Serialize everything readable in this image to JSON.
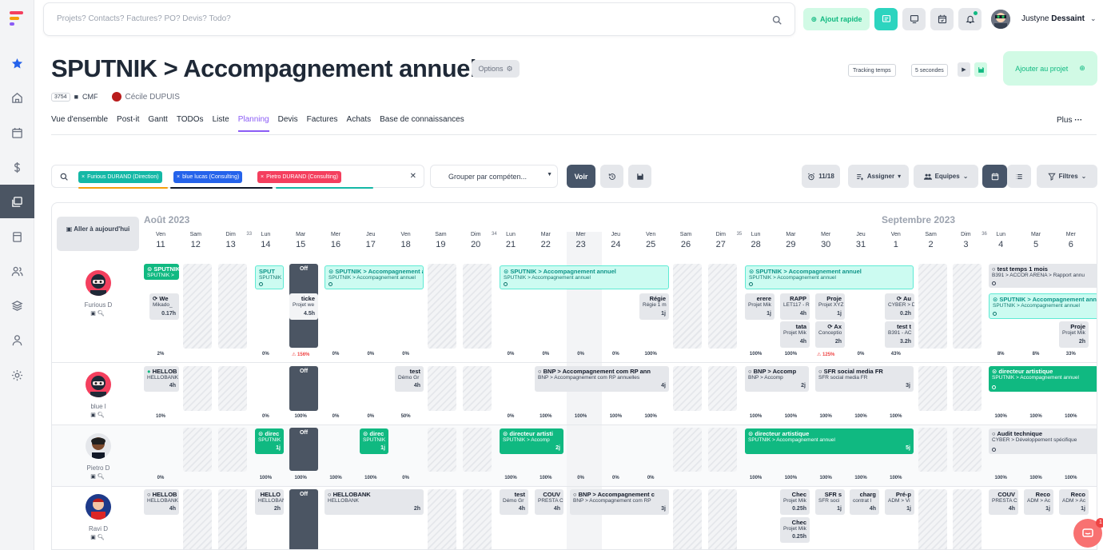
{
  "search": {
    "placeholder": "Projets? Contacts? Factures? PO? Devis? Todo?"
  },
  "topbar": {
    "ajout_rapide": "Ajout rapide"
  },
  "user": {
    "first": "Justyne",
    "last": "Dessaint"
  },
  "project": {
    "title": "SPUTNIK > Accompagnement annuel",
    "options": "Options",
    "id": "3754",
    "client": "CMF",
    "owner": "Cécile DUPUIS",
    "tracking": "Tracking temps",
    "seconds": "5 secondes",
    "add_to_project": "Ajouter au projet"
  },
  "tabs": [
    "Vue d'ensemble",
    "Post-it",
    "Gantt",
    "TODOs",
    "Liste",
    "Planning",
    "Devis",
    "Factures",
    "Achats",
    "Base de connaissances"
  ],
  "active_tab": "Planning",
  "plus": "Plus",
  "filters": {
    "chips": [
      "Furious DURAND (Direction)",
      "blue lucas (Consulting)",
      "Pietro DURAND (Consulting)"
    ],
    "grouper": "Grouper par compéten...",
    "voir": "Voir",
    "count": "11/18",
    "assigner": "Assigner",
    "equipes": "Equipes",
    "filtres": "Filtres"
  },
  "planning": {
    "today_btn": "Aller à aujourd'hui",
    "months": [
      "Août 2023",
      "Septembre 2023"
    ],
    "off_label": "Off",
    "days": [
      {
        "n": "Ven",
        "d": "11"
      },
      {
        "n": "Sam",
        "d": "12"
      },
      {
        "n": "Dim",
        "d": "13"
      },
      {
        "n": "Lun",
        "d": "14",
        "w": "33"
      },
      {
        "n": "Mar",
        "d": "15"
      },
      {
        "n": "Mer",
        "d": "16"
      },
      {
        "n": "Jeu",
        "d": "17"
      },
      {
        "n": "Ven",
        "d": "18"
      },
      {
        "n": "Sam",
        "d": "19"
      },
      {
        "n": "Dim",
        "d": "20"
      },
      {
        "n": "Lun",
        "d": "21",
        "w": "34"
      },
      {
        "n": "Mar",
        "d": "22"
      },
      {
        "n": "Mer",
        "d": "23"
      },
      {
        "n": "Jeu",
        "d": "24"
      },
      {
        "n": "Ven",
        "d": "25"
      },
      {
        "n": "Sam",
        "d": "26"
      },
      {
        "n": "Dim",
        "d": "27"
      },
      {
        "n": "Lun",
        "d": "28",
        "w": "35"
      },
      {
        "n": "Mar",
        "d": "29"
      },
      {
        "n": "Mer",
        "d": "30"
      },
      {
        "n": "Jeu",
        "d": "31"
      },
      {
        "n": "Ven",
        "d": "1"
      },
      {
        "n": "Sam",
        "d": "2"
      },
      {
        "n": "Dim",
        "d": "3"
      },
      {
        "n": "Lun",
        "d": "4",
        "w": "36"
      },
      {
        "n": "Mar",
        "d": "5"
      },
      {
        "n": "Mer",
        "d": "6"
      }
    ],
    "people": [
      {
        "name": "Furious D",
        "pct": [
          "2%",
          "",
          "",
          "0%",
          "156%",
          "0%",
          "0%",
          "0%",
          "",
          "",
          "0%",
          "0%",
          "0%",
          "0%",
          "100%",
          "",
          "",
          "100%",
          "100%",
          "125%",
          "0%",
          "43%",
          "",
          "",
          "8%",
          "8%",
          "33%"
        ]
      },
      {
        "name": "blue l",
        "pct": [
          "10%",
          "",
          "",
          "0%",
          "100%",
          "0%",
          "0%",
          "50%",
          "",
          "",
          "0%",
          "100%",
          "100%",
          "100%",
          "100%",
          "",
          "",
          "100%",
          "100%",
          "100%",
          "100%",
          "100%",
          "",
          "",
          "100%",
          "100%",
          "100%"
        ]
      },
      {
        "name": "Pietro D",
        "pct": [
          "0%",
          "",
          "",
          "100%",
          "100%",
          "100%",
          "100%",
          "0%",
          "",
          "",
          "100%",
          "100%",
          "0%",
          "0%",
          "0%",
          "",
          "",
          "100%",
          "100%",
          "100%",
          "100%",
          "100%",
          "",
          "",
          "100%",
          "100%",
          "100%"
        ]
      },
      {
        "name": "Ravi D",
        "pct": []
      }
    ],
    "tasks": {
      "sputnik": "SPUTNIK > Accompagnement annuel",
      "sputnik_short": "SPUTNIK > Accompagnement annuel",
      "sput": "SPUT",
      "sputnik_s": "SPUTNIK >",
      "we": "We",
      "mikado": "Mikado_",
      "h017": "0.17h",
      "ticke": "ticke",
      "projet_we": "Projet we",
      "h45": "4.5h",
      "regie": "Régie",
      "regie1": "Régie 1 m",
      "j1": "1j",
      "erere": "erere",
      "projet_mik": "Projet Mik",
      "rapp": "RAPP",
      "let117": "LET117 - R",
      "h4": "4h",
      "proje": "Proje",
      "projet_xyz": "Projet XYZ",
      "au": "Au",
      "cyber": "CYBER > D",
      "h02": "0.2h",
      "tata": "tata",
      "ax": "Ax",
      "concepti": "Conceptio",
      "h2": "2h",
      "testt": "test t",
      "b391": "B391 - AC",
      "h32": "3.2h",
      "test_temps": "test temps 1 mois",
      "b391_full": "B391 > ACCOR ARENA > Rapport annu",
      "hellob": "HELLOB",
      "hellobank": "HELLOBANK",
      "test": "test",
      "demo_gr": "Démo Gr",
      "bnp_com": "BNP > Accompagnement com RP ann",
      "bnp_com2": "BNP > Accompagnement com RP annuelles",
      "j4": "4j",
      "bnp_acc": "BNP > Accomp",
      "bnp_acc2": "BNP > Accomp",
      "j2": "2j",
      "sfr": "SFR social media FR",
      "j3": "3j",
      "directeur": "directeur artistique",
      "direc": "direc",
      "sputnik_sub": "SPUTNIK",
      "directeur_a": "directeur artisti",
      "sputnik_acco": "SPUTNIK > Accomp",
      "j5": "5j",
      "audit": "Audit technique",
      "cyber_dev": "CYBER > Développement spécifique",
      "hello": "HELLO",
      "h2b": "2h",
      "couv": "COUV",
      "presta": "PRESTA C",
      "bnp_c": "BNP > Accompagnement c",
      "bnp_c2": "BNP > Accompagnement com RP",
      "chec": "Chec",
      "h025": "0.25h",
      "sfrs": "SFR s",
      "sfr_soci": "SFR soci",
      "charg": "charg",
      "contrat": "contrat l",
      "prep": "Pré-p",
      "adm": "ADM > Vi",
      "reco": "Reco",
      "adm_a": "ADM > Ac"
    }
  },
  "chat_count": "1"
}
